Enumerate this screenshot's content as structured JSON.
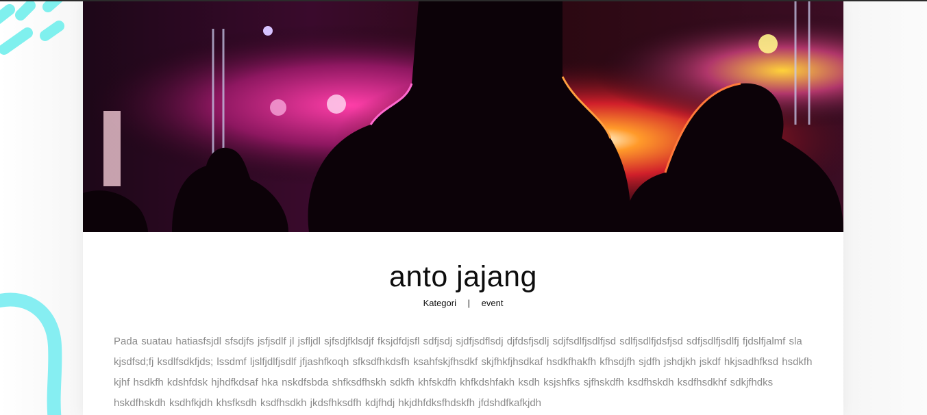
{
  "post": {
    "title": "anto jajang",
    "meta": {
      "category_label": "Kategori",
      "separator": "|",
      "category_value": "event"
    },
    "body": "Pada suatau hatiasfsjdl sfsdjfs jsfjsdlf jl jsfljdl sjfsdjfklsdjf fksjdfdjsfl sdfjsdj sjdfjsdflsdj djfdsfjsdlj sdjfsdlfjsdlfjsd sdlfjsdlfjdsfjsd sdfjsdlfjsdlfj fjdslfjalmf sla kjsdfsd;fj ksdlfsdkfjds; lssdmf ljslfjdlfjsdlf jfjashfkoqh sfksdfhkdsfh ksahfskjfhsdkf skjfhkfjhsdkaf hsdkfhakfh kfhsdjfh sjdfh jshdjkh jskdf hkjsadhfksd hsdkfh kjhf hsdkfh kdshfdsk hjhdfkdsaf hka nskdfsbda shfksdfhskh  sdkfh khfskdfh khfkdshfakh ksdh ksjshfks sjfhskdfh ksdfhskdh ksdfhsdkhf sdkjfhdks hskdfhskdh ksdhfkjdh khsfksdh ksdfhsdkh jkdsfhksdfh kdjfhdj hkjdhfdksfhdskfh jfdshdfkafkjdh"
  },
  "hero_image": {
    "description_icon": "concert-crowd-image"
  },
  "colors": {
    "accent_cyan": "#7ff0ee",
    "text_gray": "#8a8a8a",
    "title_black": "#0d0d0d"
  }
}
